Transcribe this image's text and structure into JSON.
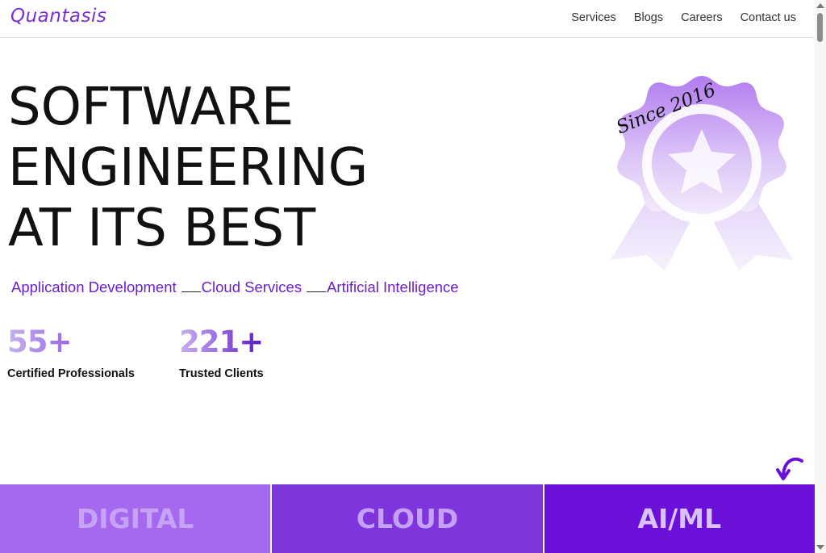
{
  "header": {
    "logo": "Quantasis",
    "nav": [
      "Services",
      "Blogs",
      "Careers",
      "Contact us"
    ]
  },
  "hero": {
    "title_lines": [
      "SOFTWARE",
      "ENGINEERING",
      "AT ITS BEST"
    ],
    "badge_text": "Since 2016",
    "services": [
      "Application Development",
      "Cloud Services",
      "Artificial Intelligence"
    ]
  },
  "stats": [
    {
      "number": "55+",
      "label": "Certified Professionals"
    },
    {
      "number": "221+",
      "label": "Trusted Clients"
    }
  ],
  "tiles": [
    {
      "label": "DIGITAL",
      "bg": "#a568ee",
      "fg": "#c7a3f7"
    },
    {
      "label": "CLOUD",
      "bg": "#7f35dc",
      "fg": "#c4a1f6"
    },
    {
      "label": "AI/ML",
      "bg": "#6a10d8",
      "fg": "#d9c2ff"
    }
  ],
  "colors": {
    "accent": "#6a1fd0",
    "brand": "#7b2fd6"
  }
}
